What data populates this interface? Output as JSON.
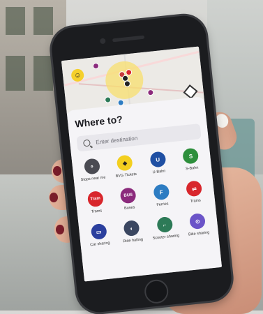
{
  "screen": {
    "title": "Where to?",
    "search_placeholder": "Enter destination",
    "tiles": [
      {
        "label": "Stops near me",
        "icon": "stops-near-me-icon",
        "color": "#4a4a52",
        "glyph": "⚬"
      },
      {
        "label": "BVG Tickets",
        "icon": "bvg-tickets-icon",
        "color": "#f3cf1f",
        "glyph": "◆"
      },
      {
        "label": "U-Bahn",
        "icon": "u-bahn-icon",
        "color": "#1f4fa3",
        "glyph": "U"
      },
      {
        "label": "S-Bahn",
        "icon": "s-bahn-icon",
        "color": "#2e8f3c",
        "glyph": "S"
      },
      {
        "label": "Trams",
        "icon": "tram-icon",
        "color": "#d8262c",
        "glyph": "Tram"
      },
      {
        "label": "Buses",
        "icon": "bus-icon",
        "color": "#8b2a7c",
        "glyph": "BUS"
      },
      {
        "label": "Ferries",
        "icon": "ferry-icon",
        "color": "#2d7cc2",
        "glyph": "F"
      },
      {
        "label": "Trains",
        "icon": "train-icon",
        "color": "#d8262c",
        "glyph": "⇌"
      },
      {
        "label": "Car sharing",
        "icon": "car-sharing-icon",
        "color": "#2b3f9e",
        "glyph": "🚗"
      },
      {
        "label": "Ride hailing",
        "icon": "ride-hailing-icon",
        "color": "#3a4660",
        "glyph": "◐"
      },
      {
        "label": "Scooter sharing",
        "icon": "scooter-sharing-icon",
        "color": "#2d7a57",
        "glyph": "🛴"
      },
      {
        "label": "Bike sharing",
        "icon": "bike-sharing-icon",
        "color": "#6b54c8",
        "glyph": "🚲"
      }
    ]
  }
}
